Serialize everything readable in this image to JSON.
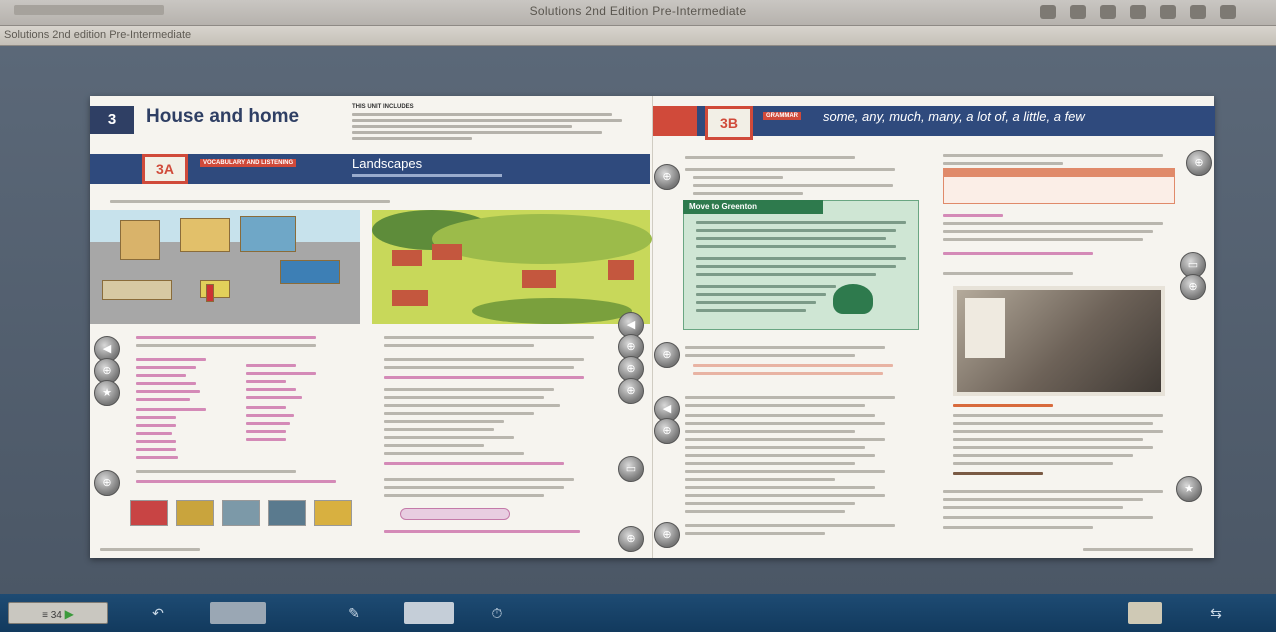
{
  "window": {
    "title": "Solutions 2nd Edition Pre-Intermediate",
    "tab_label": "Solutions 2nd edition Pre-Intermediate"
  },
  "left_page": {
    "unit_number": "3",
    "unit_title": "House and home",
    "unit_includes_label": "THIS UNIT INCLUDES",
    "lesson_code": "3A",
    "lesson_kicker": "VOCABULARY AND LISTENING",
    "lesson_title": "Landscapes"
  },
  "right_page": {
    "lesson_code": "3B",
    "lesson_kicker": "GRAMMAR",
    "lesson_title": "some, any, much, many, a lot of, a little, a few",
    "reading_title": "Move to Greenton"
  },
  "toolbar": {
    "page_box_text": "≡ 34",
    "play_glyph": "▶",
    "back_glyph": "↶",
    "pencil_glyph": "✎",
    "timer_glyph": "⏱",
    "swap_glyph": "⇆"
  },
  "icons": {
    "audio": "audio-icon",
    "star": "star-icon",
    "zoom": "zoom-icon"
  }
}
